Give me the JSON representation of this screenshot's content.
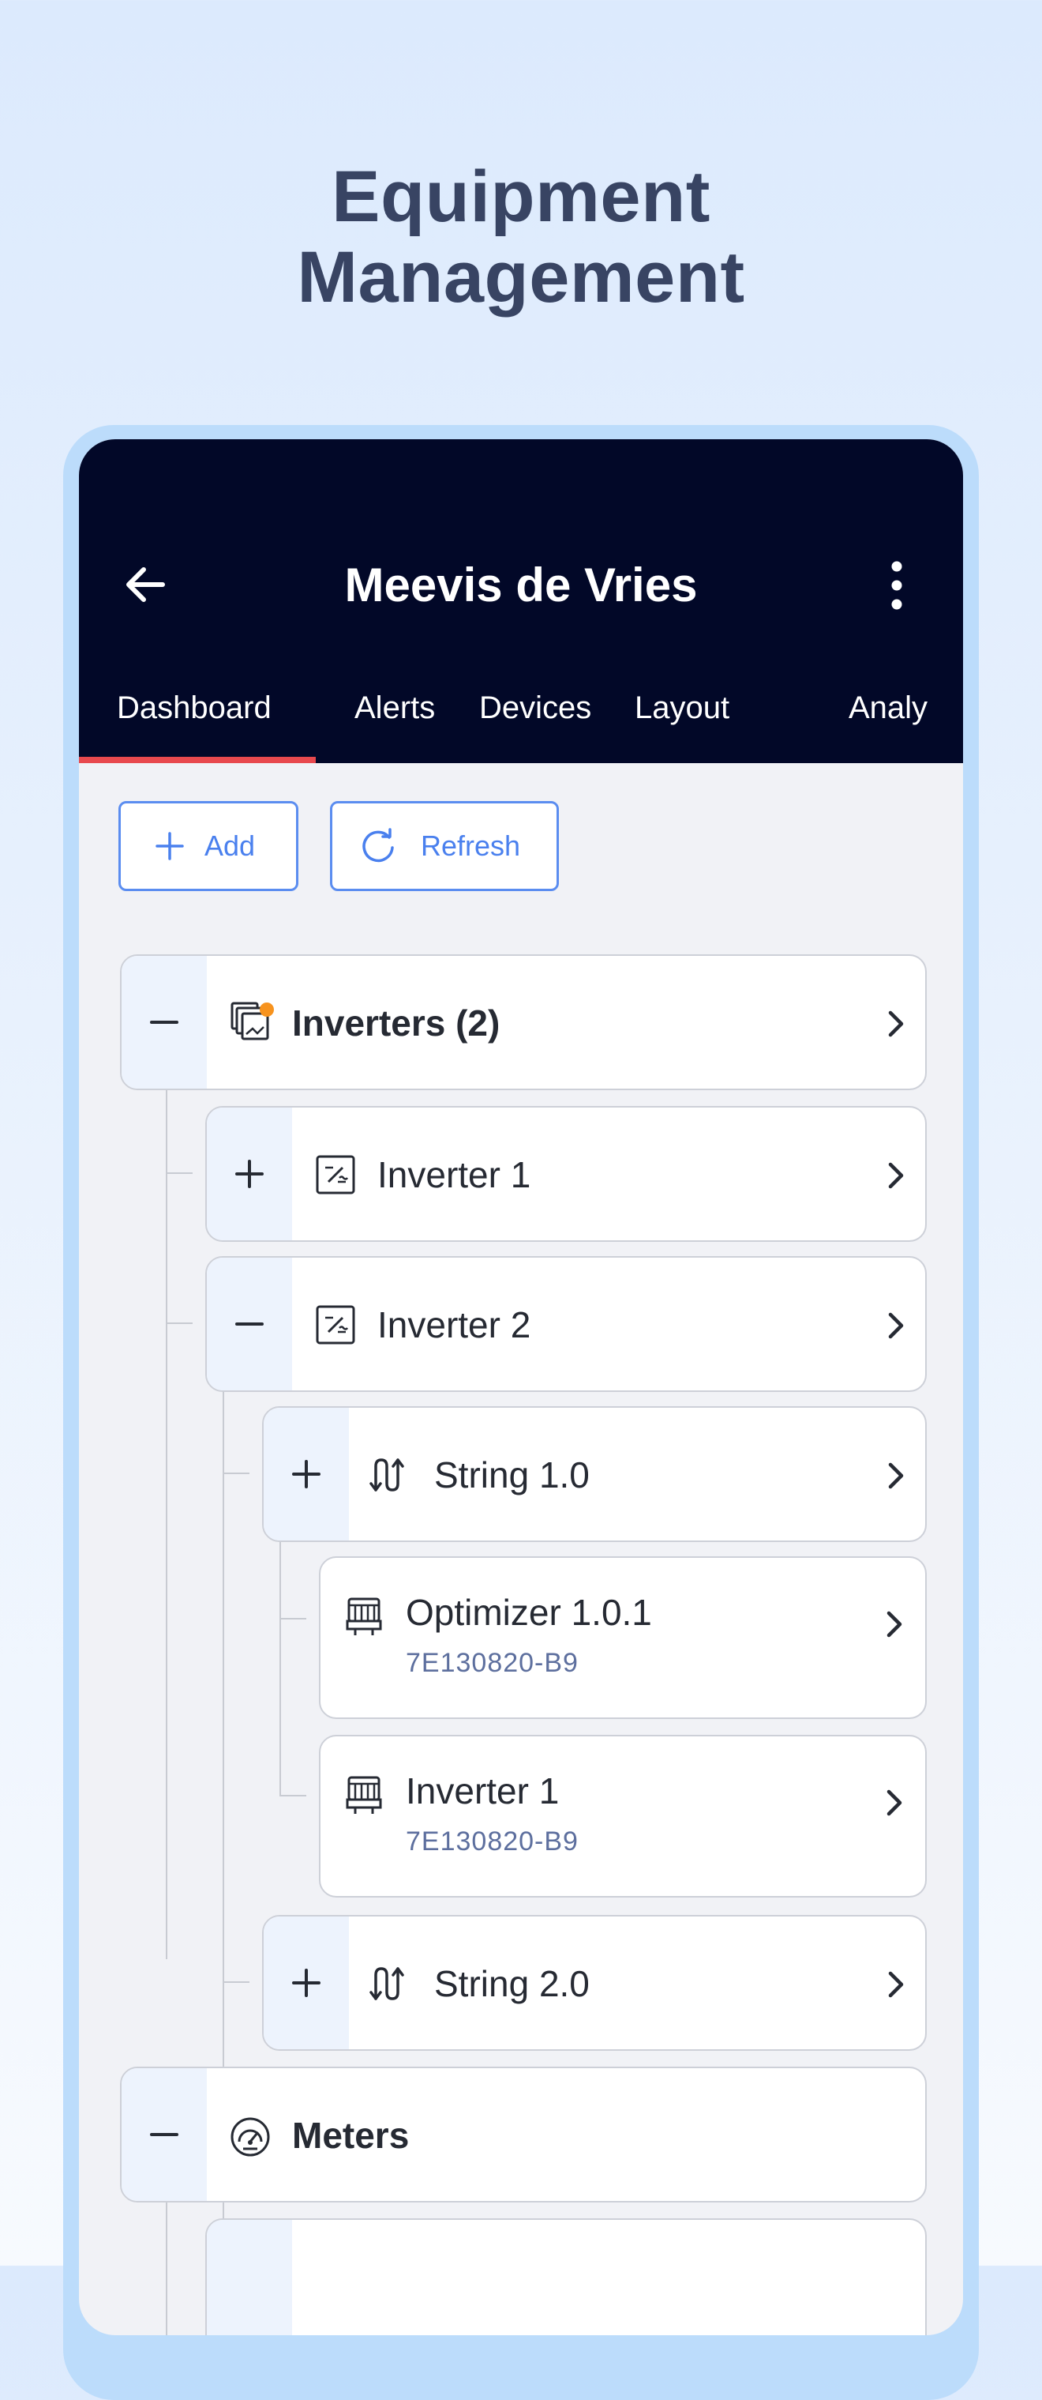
{
  "headline": {
    "line1": "Equipment",
    "line2": "Management"
  },
  "appbar": {
    "title": "Meevis de Vries",
    "back_icon": "arrow-left-icon",
    "menu_icon": "more-vertical-icon"
  },
  "tabs": [
    {
      "label": "Dashboard",
      "active": true
    },
    {
      "label": "Alerts"
    },
    {
      "label": "Devices"
    },
    {
      "label": "Layout"
    },
    {
      "label": "Analy"
    }
  ],
  "toolbar": {
    "add_label": "Add",
    "refresh_label": "Refresh"
  },
  "tree": {
    "inverters_group": {
      "label": "Inverters (2)",
      "expanded": true,
      "icon": "inverter-group-icon",
      "alert_dot": true
    },
    "inverter_1": {
      "label": "Inverter 1",
      "expanded": false,
      "icon": "inverter-icon"
    },
    "inverter_2": {
      "label": "Inverter 2",
      "expanded": true,
      "icon": "inverter-icon"
    },
    "string_1": {
      "label": "String 1.0",
      "expanded": false,
      "icon": "string-icon"
    },
    "optimizer_1": {
      "label": "Optimizer 1.0.1",
      "serial": "7E130820-B9",
      "icon": "optimizer-icon"
    },
    "inverter_1b": {
      "label": "Inverter 1",
      "serial": "7E130820-B9",
      "icon": "optimizer-icon"
    },
    "string_2": {
      "label": "String 2.0",
      "expanded": false,
      "icon": "string-icon"
    },
    "meters_group": {
      "label": "Meters",
      "expanded": true,
      "icon": "gauge-icon"
    }
  },
  "colors": {
    "appbar": "#020828",
    "accent": "#4a80ee",
    "tab_indicator": "#e8494e",
    "alert_dot": "#f7931e"
  }
}
